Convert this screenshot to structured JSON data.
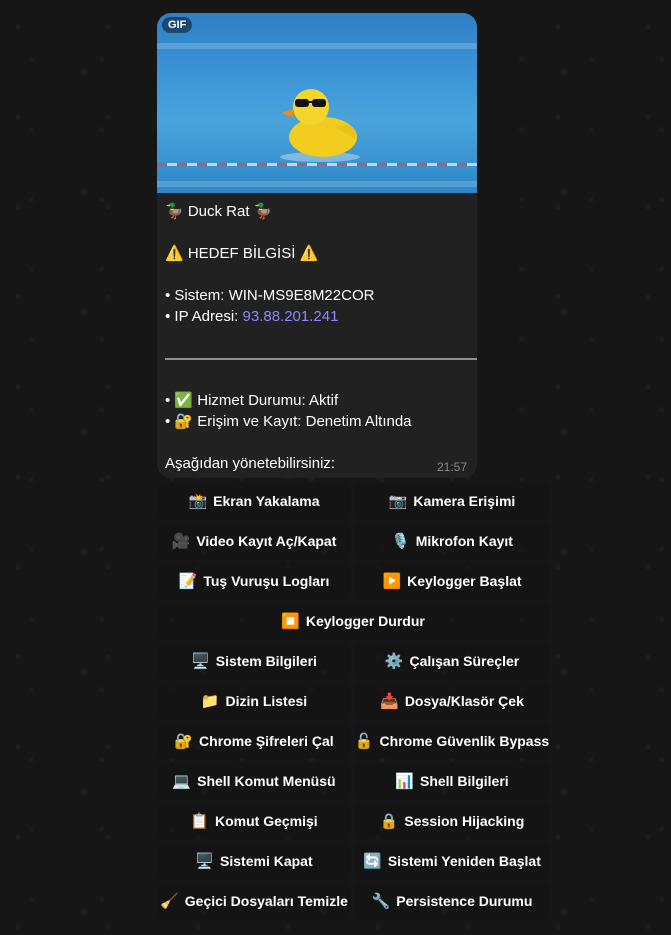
{
  "message": {
    "media_badge": "GIF",
    "title": "🦆 Duck Rat 🦆",
    "target_header": "⚠️ HEDEF BİLGİSİ ⚠️",
    "system_line": "• Sistem: WIN-MS9E8M22COR",
    "ip_label": "• IP Adresi: ",
    "ip_value": "93.88.201.241",
    "divider": "———————————————————————",
    "service_status": "• ✅ Hizmet Durumu: Aktif",
    "access_log": "• 🔐 Erişim ve Kayıt: Denetim Altında",
    "footer": "Aşağıdan yönetebilirsiniz:",
    "time": "21:57"
  },
  "keyboard": {
    "rows": [
      [
        {
          "icon": "📸",
          "label": "Ekran Yakalama"
        },
        {
          "icon": "📷",
          "label": "Kamera Erişimi"
        }
      ],
      [
        {
          "icon": "🎥",
          "label": "Video Kayıt Aç/Kapat"
        },
        {
          "icon": "🎙️",
          "label": "Mikrofon Kayıt"
        }
      ],
      [
        {
          "icon": "📝",
          "label": "Tuş Vuruşu Logları"
        },
        {
          "icon": "▶️",
          "label": "Keylogger Başlat"
        }
      ],
      [
        {
          "icon": "⏹️",
          "label": "Keylogger Durdur"
        }
      ],
      [
        {
          "icon": "🖥️",
          "label": "Sistem Bilgileri"
        },
        {
          "icon": "⚙️",
          "label": "Çalışan Süreçler"
        }
      ],
      [
        {
          "icon": "📁",
          "label": "Dizin Listesi"
        },
        {
          "icon": "📥",
          "label": "Dosya/Klasör Çek"
        }
      ],
      [
        {
          "icon": "🔐",
          "label": "Chrome Şifreleri Çal"
        },
        {
          "icon": "🔓",
          "label": "Chrome Güvenlik Bypass"
        }
      ],
      [
        {
          "icon": "💻",
          "label": "Shell Komut Menüsü"
        },
        {
          "icon": "📊",
          "label": "Shell Bilgileri"
        }
      ],
      [
        {
          "icon": "📋",
          "label": "Komut Geçmişi"
        },
        {
          "icon": "🔒",
          "label": "Session Hijacking"
        }
      ],
      [
        {
          "icon": "🖥️",
          "label": "Sistemi Kapat"
        },
        {
          "icon": "🔄",
          "label": "Sistemi Yeniden Başlat"
        }
      ],
      [
        {
          "icon": "🧹",
          "label": "Geçici Dosyaları Temizle"
        },
        {
          "icon": "🔧",
          "label": "Persistence Durumu"
        }
      ]
    ]
  }
}
